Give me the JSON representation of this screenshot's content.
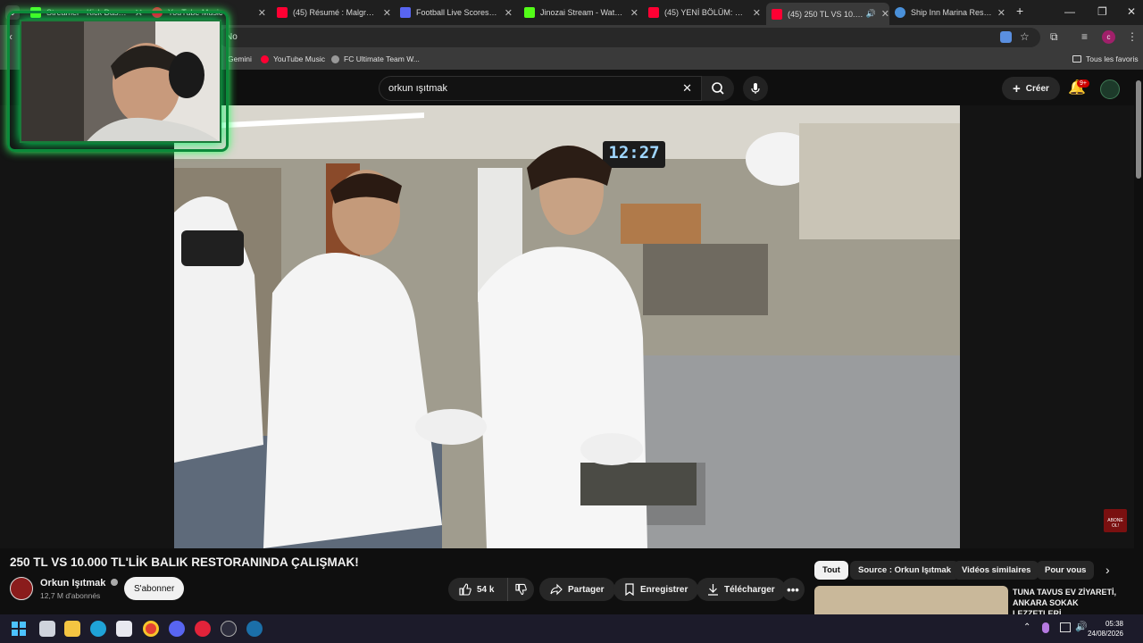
{
  "tabs": [
    {
      "title": "Streamer - Kick Dashboard",
      "color": "#53fc18"
    },
    {
      "title": "YouTube Music",
      "color": "#ff0033"
    },
    {
      "title": "(45) Résumé : Malgré Tros",
      "color": "#ff0033"
    },
    {
      "title": "Football Live Scores, Fixtu",
      "color": "#5865f2"
    },
    {
      "title": "Jinozai Stream - Watch Li",
      "color": "#53fc18"
    },
    {
      "title": "(45) YENİ BÖLÜM: SOĞUK",
      "color": "#ff0033"
    },
    {
      "title": "(45) 250 TL VS 10.000",
      "color": "#ff0033"
    },
    {
      "title": "Ship Inn Marina Restaura",
      "color": "#4a90d9"
    }
  ],
  "omnibox": {
    "text": "No"
  },
  "bookmarks": {
    "items": [
      "Gemini",
      "YouTube Music",
      "FC Ultimate Team W..."
    ],
    "all_label": "Tous les favoris"
  },
  "header": {
    "search_value": "orkun ışıtmak",
    "create_label": "Créer",
    "notif_count": "9+"
  },
  "video": {
    "title": "250 TL VS 10.000 TL'LİK BALIK RESTORANINDA ÇALIŞMAK!",
    "channel": "Orkun Işıtmak",
    "subscribers": "12,7 M d'abonnés",
    "subscribe_label": "S'abonner",
    "likes": "54 k",
    "share_label": "Partager",
    "save_label": "Enregistrer",
    "download_label": "Télécharger",
    "clock_text": "12:27",
    "watermark_text": "ABONE OL!"
  },
  "filters": [
    "Tout",
    "Source : Orkun Işıtmak",
    "Vidéos similaires",
    "Pour vous"
  ],
  "recommendation": {
    "title": "TUNA TAVUS EV ZİYARETİ, ANKARA SOKAK LEZZETLERİ"
  },
  "taskbar": {
    "time": "05:38",
    "date": "24/08/2026"
  },
  "colors": {
    "brand": "#ff0033",
    "kick": "#53fc18",
    "accent": "#f1f1f1"
  }
}
